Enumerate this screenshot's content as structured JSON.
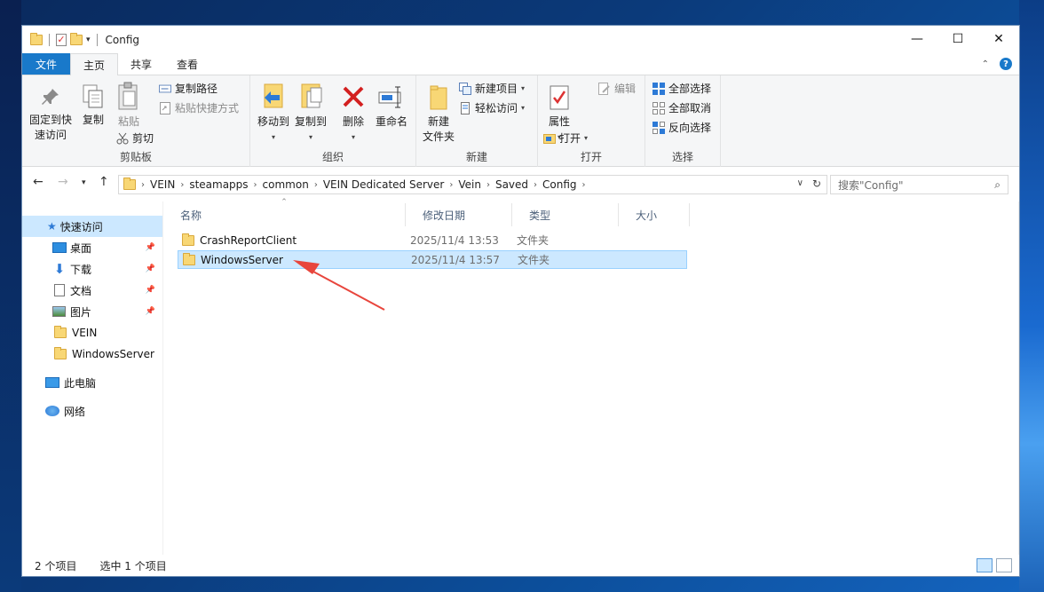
{
  "window": {
    "title": "Config",
    "controls": {
      "minimize": "—",
      "maximize": "☐",
      "close": "✕"
    }
  },
  "ribbon_tabs": [
    "文件",
    "主页",
    "共享",
    "查看"
  ],
  "ribbon": {
    "clipboard": {
      "label": "剪贴板",
      "pin": [
        "固定到快",
        "速访问"
      ],
      "copy": "复制",
      "paste": "粘贴",
      "copy_path": "复制路径",
      "paste_shortcut": "粘贴快捷方式",
      "cut": "剪切"
    },
    "organize": {
      "label": "组织",
      "move_to": "移动到",
      "copy_to": "复制到",
      "delete": "删除",
      "rename": "重命名"
    },
    "new": {
      "label": "新建",
      "new_folder": [
        "新建",
        "文件夹"
      ],
      "new_item": "新建项目",
      "easy_access": "轻松访问"
    },
    "open": {
      "label": "打开",
      "properties": "属性",
      "open": "打开",
      "edit": "编辑"
    },
    "select": {
      "label": "选择",
      "select_all": "全部选择",
      "select_none": "全部取消",
      "invert": "反向选择"
    }
  },
  "address": {
    "breadcrumbs": [
      "VEIN",
      "steamapps",
      "common",
      "VEIN Dedicated Server",
      "Vein",
      "Saved",
      "Config"
    ],
    "search_placeholder": "搜索\"Config\""
  },
  "nav_pane": {
    "quick_access": "快速访问",
    "items": [
      {
        "label": "桌面",
        "pinned": true
      },
      {
        "label": "下载",
        "pinned": true
      },
      {
        "label": "文档",
        "pinned": true
      },
      {
        "label": "图片",
        "pinned": true
      },
      {
        "label": "VEIN",
        "pinned": false
      },
      {
        "label": "WindowsServer",
        "pinned": false
      }
    ],
    "this_pc": "此电脑",
    "network": "网络"
  },
  "columns": [
    "名称",
    "修改日期",
    "类型",
    "大小"
  ],
  "files": [
    {
      "name": "CrashReportClient",
      "date": "2025/11/4 13:53",
      "type": "文件夹",
      "selected": false
    },
    {
      "name": "WindowsServer",
      "date": "2025/11/4 13:57",
      "type": "文件夹",
      "selected": true
    }
  ],
  "status": {
    "count": "2 个项目",
    "selected": "选中 1 个项目"
  },
  "colors": {
    "accent": "#1979ca",
    "selection": "#cce8ff",
    "annotation_arrow": "#e8453c"
  }
}
